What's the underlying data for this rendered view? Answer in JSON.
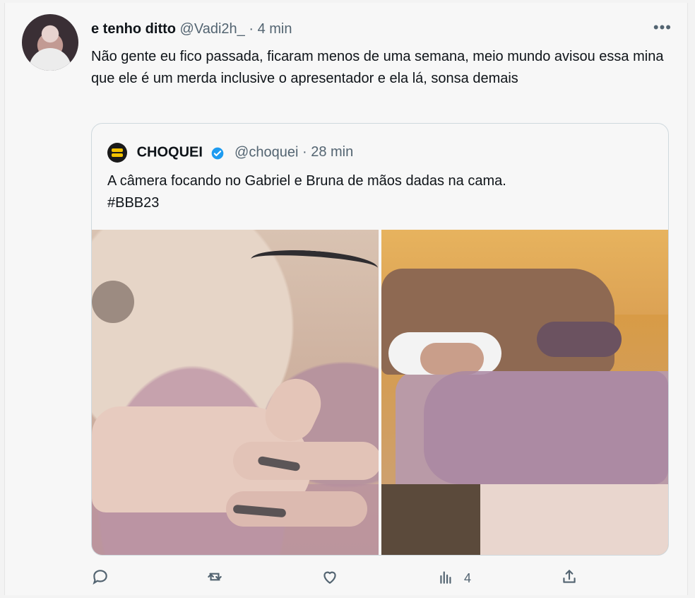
{
  "tweet": {
    "author_name": "e tenho ditto",
    "author_handle": "@Vadi2h_",
    "separator": "·",
    "time": "4 min",
    "text": "Não gente eu fico passada, ficaram menos de uma semana, meio mundo avisou essa mina que ele é um merda inclusive o apresentador e ela lá, sonsa demais",
    "more_icon": "more-horizontal-icon"
  },
  "quoted": {
    "author_name": "CHOQUEI",
    "author_handle": "@choquei",
    "separator": "·",
    "time": "28 min",
    "verified": true,
    "text_line1": "A câmera focando no Gabriel e Bruna de mãos dadas na cama.",
    "text_line2": "#BBB23",
    "accent": "#1d9bf0"
  },
  "actions": {
    "reply_icon": "reply-icon",
    "retweet_icon": "retweet-icon",
    "like_icon": "like-icon",
    "views_icon": "views-icon",
    "views_count": "4",
    "share_icon": "share-icon"
  }
}
